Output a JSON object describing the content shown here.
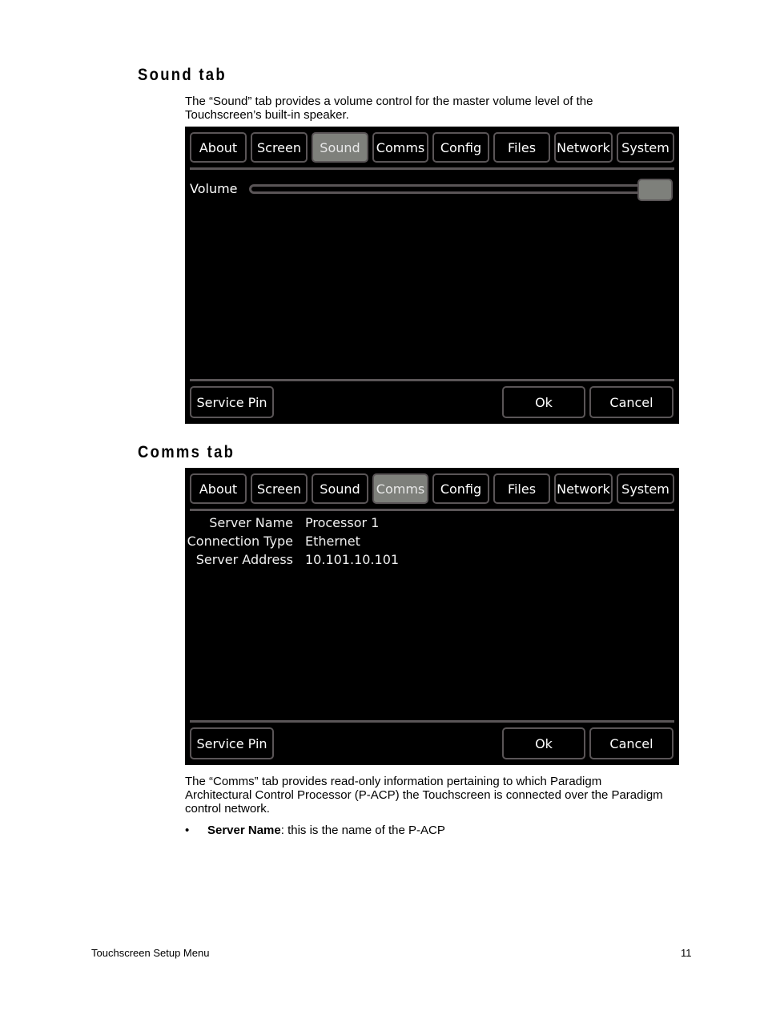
{
  "sound_section": {
    "heading": "Sound tab",
    "description_line1": "The “Sound” tab provides a volume control for the master volume level of the",
    "description_line2": "Touchscreen’s built-in speaker.",
    "screen": {
      "tabs": [
        {
          "label": "About",
          "active": false
        },
        {
          "label": "Screen",
          "active": false
        },
        {
          "label": "Sound",
          "active": true
        },
        {
          "label": "Comms",
          "active": false
        },
        {
          "label": "Config",
          "active": false
        },
        {
          "label": "Files",
          "active": false
        },
        {
          "label": "Network",
          "active": false
        },
        {
          "label": "System",
          "active": false
        }
      ],
      "volume_label": "Volume",
      "volume_level_percent": 100,
      "service_pin_label": "Service Pin",
      "ok_label": "Ok",
      "cancel_label": "Cancel"
    }
  },
  "comms_section": {
    "heading": "Comms tab",
    "screen": {
      "tabs": [
        {
          "label": "About",
          "active": false
        },
        {
          "label": "Screen",
          "active": false
        },
        {
          "label": "Sound",
          "active": false
        },
        {
          "label": "Comms",
          "active": true
        },
        {
          "label": "Config",
          "active": false
        },
        {
          "label": "Files",
          "active": false
        },
        {
          "label": "Network",
          "active": false
        },
        {
          "label": "System",
          "active": false
        }
      ],
      "info": [
        {
          "label": "Server Name",
          "value": "Processor 1"
        },
        {
          "label": "Connection Type",
          "value": "Ethernet"
        },
        {
          "label": "Server Address",
          "value": "10.101.10.101"
        }
      ],
      "service_pin_label": "Service Pin",
      "ok_label": "Ok",
      "cancel_label": "Cancel"
    },
    "description_line1": "The “Comms” tab provides read-only information pertaining to which Paradigm",
    "description_line2": "Architectural Control Processor (P-ACP) the Touchscreen is connected over the Paradigm",
    "description_line3": "control network.",
    "bullets": [
      {
        "symbol": "•",
        "term": "Server Name",
        "text": ": this is the name of the P-ACP"
      }
    ]
  },
  "footer": {
    "title": "Touchscreen Setup Menu",
    "page_number": "11"
  }
}
